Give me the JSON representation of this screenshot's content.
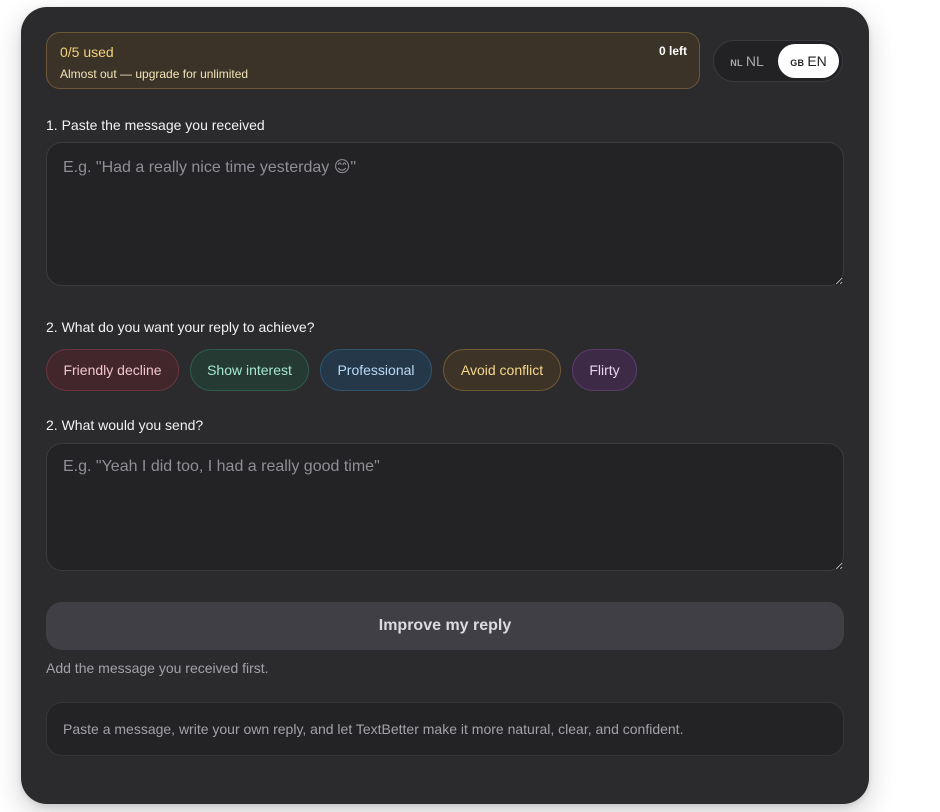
{
  "usage": {
    "count": "0/5 used",
    "remaining": "0 left",
    "note": "Almost out — upgrade for unlimited"
  },
  "language": {
    "options": [
      {
        "flag": "NL",
        "code": "NL",
        "selected": false
      },
      {
        "flag": "GB",
        "code": "EN",
        "selected": true
      }
    ]
  },
  "received": {
    "label": "1. Paste the message you received",
    "placeholder": "E.g. \"Had a really nice time yesterday 😊\""
  },
  "goal": {
    "label": "2. What do you want your reply to achieve?",
    "chips": [
      {
        "label": "Friendly decline",
        "color": "#f3c6cf"
      },
      {
        "label": "Show interest",
        "color": "#a7e7cf"
      },
      {
        "label": "Professional",
        "color": "#b8dbf5"
      },
      {
        "label": "Avoid conflict",
        "color": "#f5d98b"
      },
      {
        "label": "Flirty",
        "color": "#ecd1f6"
      }
    ]
  },
  "draft": {
    "label": "2. What would you send?",
    "placeholder": "E.g. \"Yeah I did too, I had a really good time\""
  },
  "submit": {
    "label": "Improve my reply"
  },
  "hint": "Add the message you received first.",
  "info": "Paste a message, write your own reply, and let TextBetter make it more natural, clear, and confident.",
  "colors": {
    "card_bg": "#2b2b2e",
    "accent_warning": "#f2d27a",
    "button_bg": "#3f3f45"
  }
}
